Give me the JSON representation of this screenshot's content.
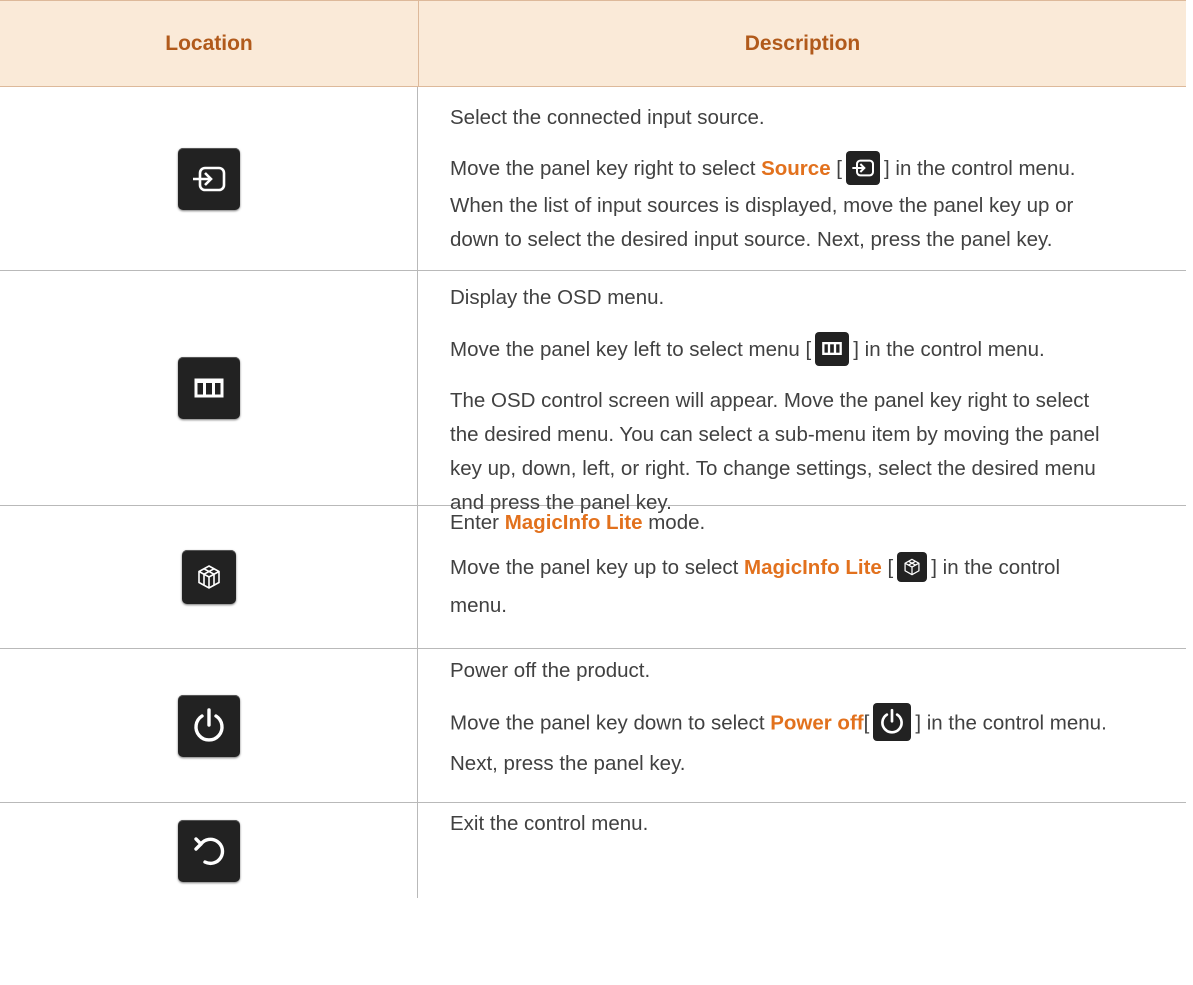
{
  "table": {
    "header_location": "Location",
    "header_description": "Description"
  },
  "rows": [
    {
      "icon": "source-icon",
      "lines": [
        "Select the connected input source.",
        {
          "pre": "Move the panel key right to select ",
          "hl": "Source",
          "mid": " [",
          "post": "] in the control menu."
        },
        "When the list of input sources is displayed, move the panel key up or down to select the desired input source. Next, press the panel key."
      ],
      "l1": "Select the connected input source.",
      "l2_pre": "Move the panel key right to select ",
      "l2_hl": "Source",
      "l2_post": " in the control menu.",
      "l3": "When the list of input sources is displayed, move the panel key up or",
      "l3b": "down to select the desired input source. Next, press the panel key."
    },
    {
      "icon": "menu-icon",
      "l1": "Display the OSD menu.",
      "l2_pre": "Move the panel key left to select menu ",
      "l2_post": " in the control menu.",
      "l3": "The OSD control screen will appear. Move the panel key right to select",
      "l3b": "the desired menu. You can select a sub-menu item by moving the panel",
      "l3c": "key up, down, left, or right. To change settings, select the desired menu",
      "l3d": "and press the panel key."
    },
    {
      "icon": "magicinfo-icon",
      "l1_pre": "Enter ",
      "l1_hl": "MagicInfo Lite",
      "l1_post": " mode.",
      "l2_pre": "Move the panel key up to select ",
      "l2_hl": "MagicInfo Lite",
      "l2_post": " in the control",
      "l2b": "menu."
    },
    {
      "icon": "power-icon",
      "l1": "Power off the product.",
      "l2_pre": "Move the panel key down to select ",
      "l2_hl": "Power off",
      "l2_post": " in the control menu.",
      "l3": "Next, press the panel key."
    },
    {
      "icon": "return-icon",
      "l1": "Exit the control menu."
    }
  ],
  "colors": {
    "header_bg": "#faead8",
    "header_text": "#b15a1b",
    "highlight": "#e2711d",
    "key_bg": "#222222"
  }
}
